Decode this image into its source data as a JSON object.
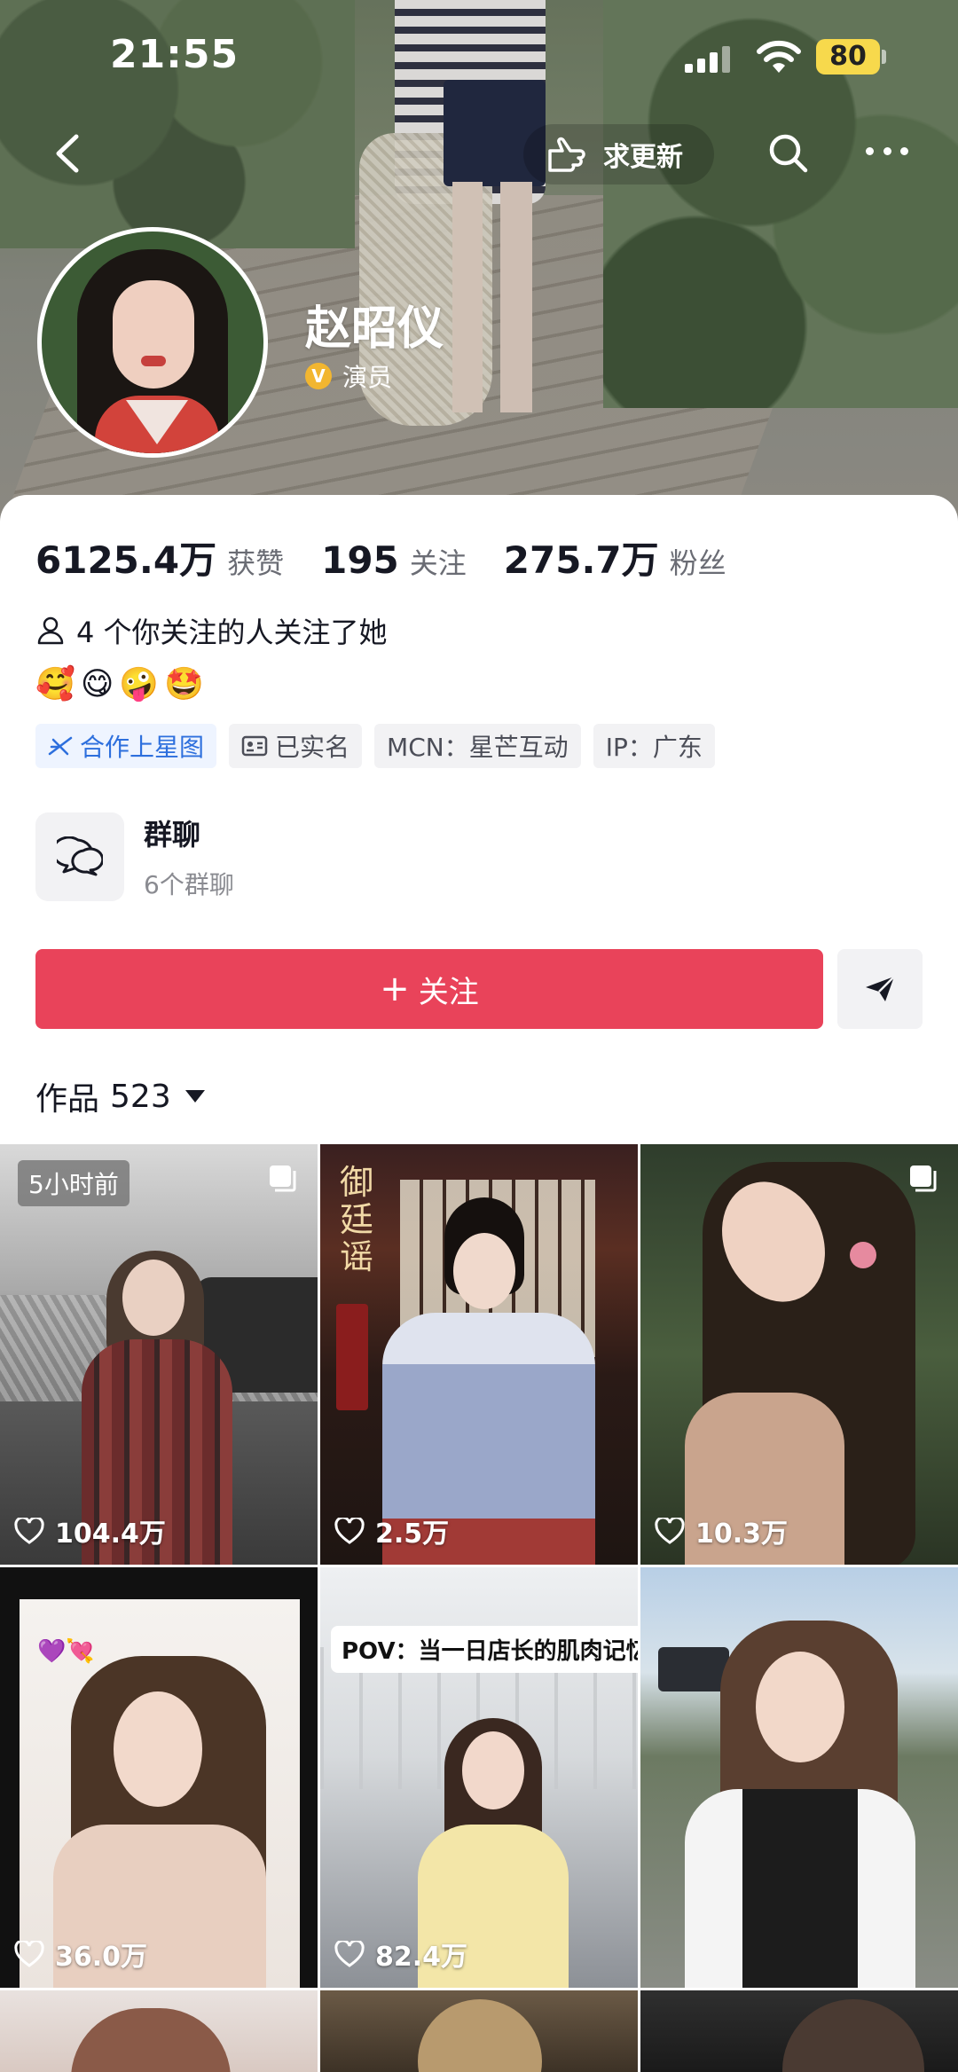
{
  "status_bar": {
    "time": "21:55",
    "battery": "80"
  },
  "nav": {
    "request_update": "求更新"
  },
  "profile": {
    "name": "赵昭仪",
    "verified_role": "演员",
    "verified_mark": "V",
    "stats": [
      {
        "num": "6125.4万",
        "label": "获赞"
      },
      {
        "num": "195",
        "label": "关注"
      },
      {
        "num": "275.7万",
        "label": "粉丝"
      }
    ],
    "mutual_follow": "4 个你关注的人关注了她",
    "emojis": "🥰😋🤪🤩",
    "tags": [
      "合作上星图",
      "已实名",
      "MCN：星芒互动",
      "IP：广东"
    ]
  },
  "group": {
    "title": "群聊",
    "subtitle": "6个群聊"
  },
  "actions": {
    "follow_plus": "+",
    "follow_label": "关注"
  },
  "works": {
    "label": "作品",
    "count": "523"
  },
  "grid": [
    {
      "likes": "104.4万",
      "badge": "5小时前"
    },
    {
      "likes": "2.5万",
      "title": "御廷谣"
    },
    {
      "likes": "10.3万"
    },
    {
      "likes": "36.0万",
      "emoji": "💜💘"
    },
    {
      "likes": "82.4万",
      "caption": "POV：当一日店长的肌肉记忆"
    },
    {
      "likes": ""
    }
  ],
  "colors": {
    "follow": "#e9435a",
    "blue_tag": "#2d6fdd",
    "battery": "#f7d94c"
  },
  "icons": [
    "back-icon",
    "hand-point-icon",
    "search-icon",
    "more-icon",
    "person-icon",
    "star-map-icon",
    "id-card-icon",
    "chat-bubbles-icon",
    "share-arrow-icon",
    "heart-icon",
    "multi-image-icon"
  ]
}
